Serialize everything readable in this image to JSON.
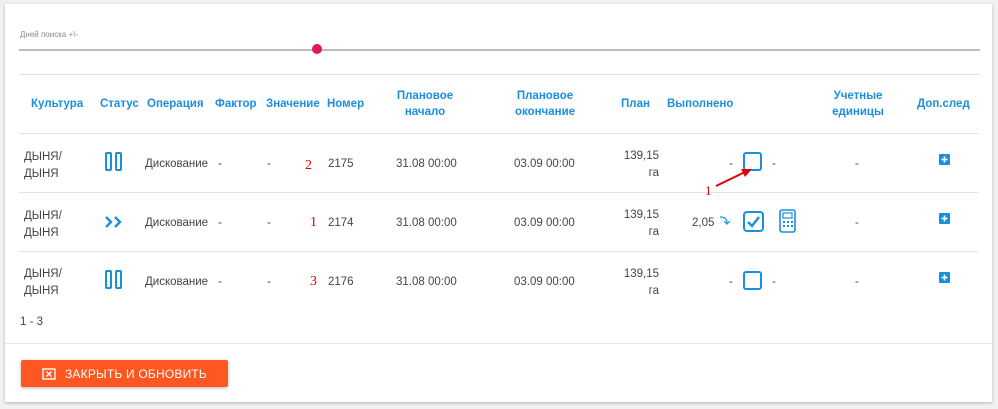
{
  "slider": {
    "label": "Дней поиска +\\-",
    "value": 0.31
  },
  "columns": {
    "culture": "Культура",
    "status": "Статус",
    "operation": "Операция",
    "factor": "Фактор",
    "value": "Значение",
    "number": "Номер",
    "plan_start_1": "Плановое",
    "plan_start_2": "начало",
    "plan_end_1": "Плановое",
    "plan_end_2": "окончание",
    "plan": "План",
    "done": "Выполнено",
    "units_1": "Учетные",
    "units_2": "единицы",
    "extra": "Доп.след"
  },
  "rows": [
    {
      "culture_1": "ДЫНЯ/",
      "culture_2": "ДЫНЯ",
      "status_icon": "pause-icon",
      "operation": "Дискование",
      "factor": "-",
      "value": "-",
      "annot": "2",
      "number": "2175",
      "plan_start": "31.08 00:00",
      "plan_end": "03.09 00:00",
      "plan_value": "139,15",
      "plan_unit": "га",
      "done_value": "-",
      "done_checked": false,
      "done_after": "-",
      "units": "-"
    },
    {
      "culture_1": "ДЫНЯ/",
      "culture_2": "ДЫНЯ",
      "status_icon": "fast-forward-icon",
      "operation": "Дискование",
      "factor": "-",
      "value": "-",
      "annot": "1",
      "number": "2174",
      "plan_start": "31.08 00:00",
      "plan_end": "03.09 00:00",
      "plan_value": "139,15",
      "plan_unit": "га",
      "done_value": "2,05",
      "done_checked": true,
      "done_after": "",
      "units": "-"
    },
    {
      "culture_1": "ДЫНЯ/",
      "culture_2": "ДЫНЯ",
      "status_icon": "pause-icon",
      "operation": "Дискование",
      "factor": "-",
      "value": "-",
      "annot": "3",
      "number": "2176",
      "plan_start": "31.08 00:00",
      "plan_end": "03.09 00:00",
      "plan_value": "139,15",
      "plan_unit": "га",
      "done_value": "-",
      "done_checked": false,
      "done_after": "-",
      "units": "-"
    }
  ],
  "annotation_arrow_label": "1",
  "pager": "1 - 3",
  "close_button": "ЗАКРЫТЬ И ОБНОВИТЬ",
  "colors": {
    "accent": "#1a8fe0",
    "button": "#ff5722",
    "thumb": "#e2175c",
    "annotation": "#e00000"
  }
}
